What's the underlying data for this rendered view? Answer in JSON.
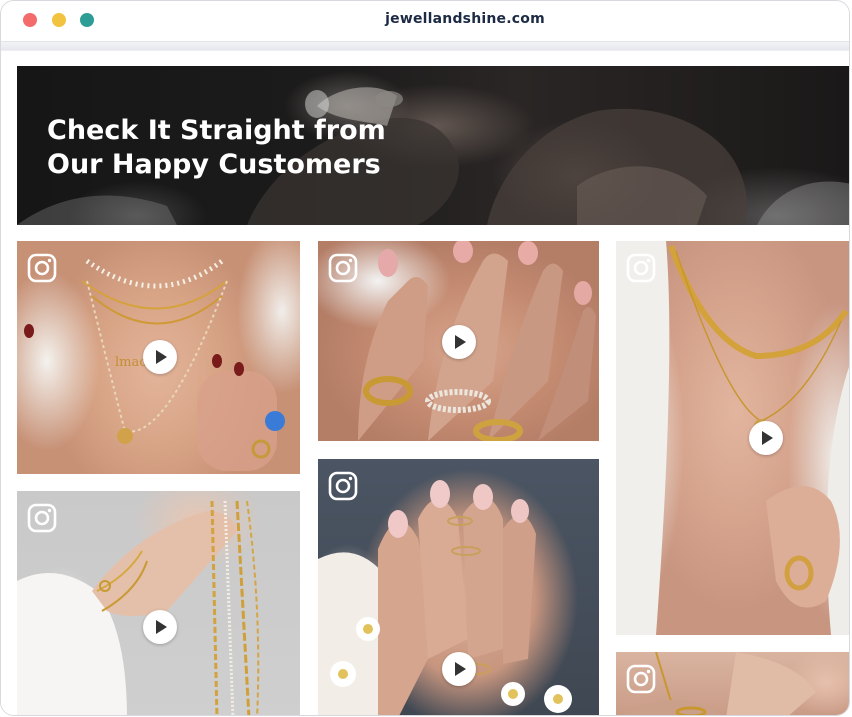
{
  "browser": {
    "url": "jewellandshine.com",
    "traffic_lights": [
      "close",
      "minimize",
      "zoom"
    ]
  },
  "hero": {
    "title_line1": "Check It Straight from",
    "title_line2": "Our Happy Customers"
  },
  "gallery": {
    "tiles": [
      {
        "id": "tile-1",
        "source_icon": "instagram-icon",
        "media": "video",
        "play_icon": "play-icon"
      },
      {
        "id": "tile-2",
        "source_icon": "instagram-icon",
        "media": "video",
        "play_icon": "play-icon"
      },
      {
        "id": "tile-3",
        "source_icon": "instagram-icon",
        "media": "video",
        "play_icon": "play-icon"
      },
      {
        "id": "tile-4",
        "source_icon": "instagram-icon",
        "media": "video",
        "play_icon": "play-icon"
      },
      {
        "id": "tile-5",
        "source_icon": "instagram-icon",
        "media": "video",
        "play_icon": "play-icon"
      },
      {
        "id": "tile-6",
        "source_icon": "instagram-icon",
        "media": "image"
      }
    ]
  },
  "colors": {
    "close": "#f46b6b",
    "minimize": "#f1c33e",
    "zoom": "#2e9d96",
    "url_text": "#1c2a44",
    "hero_text": "#ffffff"
  }
}
